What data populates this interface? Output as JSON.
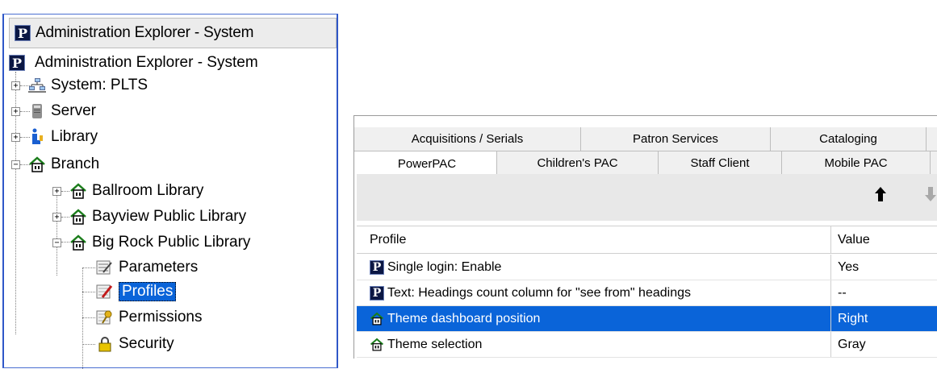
{
  "tree_window": {
    "title": "Administration Explorer - System",
    "root_label": "Administration Explorer - System",
    "items": [
      {
        "label": "System: PLTS",
        "icon": "network-icon",
        "expander": "+"
      },
      {
        "label": "Server",
        "icon": "server-icon",
        "expander": "+"
      },
      {
        "label": "Library",
        "icon": "library-icon",
        "expander": "+"
      },
      {
        "label": "Branch",
        "icon": "branch-house-icon",
        "expander": "−"
      },
      {
        "label": "Ballroom Library",
        "icon": "branch-house-icon",
        "expander": "+"
      },
      {
        "label": "Bayview Public Library",
        "icon": "branch-house-icon",
        "expander": "+"
      },
      {
        "label": "Big Rock Public Library",
        "icon": "branch-house-icon",
        "expander": "−"
      },
      {
        "label": "Parameters",
        "icon": "parameters-icon"
      },
      {
        "label": "Profiles",
        "icon": "profiles-icon",
        "selected": true
      },
      {
        "label": "Permissions",
        "icon": "permissions-icon"
      },
      {
        "label": "Security",
        "icon": "padlock-icon"
      }
    ]
  },
  "profile_window": {
    "tabs_row1": [
      "Acquisitions / Serials",
      "Patron Services",
      "Cataloging"
    ],
    "tabs_row2": [
      "PowerPAC",
      "Children's PAC",
      "Staff Client",
      "Mobile PAC"
    ],
    "active_tab": "PowerPAC",
    "toolbar": {
      "up_icon": "arrow-up-icon",
      "down_icon": "arrow-down-icon"
    },
    "columns": {
      "profile": "Profile",
      "value": "Value"
    },
    "rows": [
      {
        "icon": "polaris-p-icon",
        "profile": "Single login: Enable",
        "value": "Yes"
      },
      {
        "icon": "polaris-p-icon",
        "profile": "Text: Headings count column for \"see from\" headings",
        "value": "--"
      },
      {
        "icon": "branch-house-icon",
        "profile": "Theme dashboard position",
        "value": "Right",
        "selected": true
      },
      {
        "icon": "branch-house-icon",
        "profile": "Theme selection",
        "value": "Gray"
      }
    ]
  },
  "colors": {
    "selection": "#0a64d9",
    "window_border": "#2f57c8",
    "house_green": "#1b7d1b"
  }
}
